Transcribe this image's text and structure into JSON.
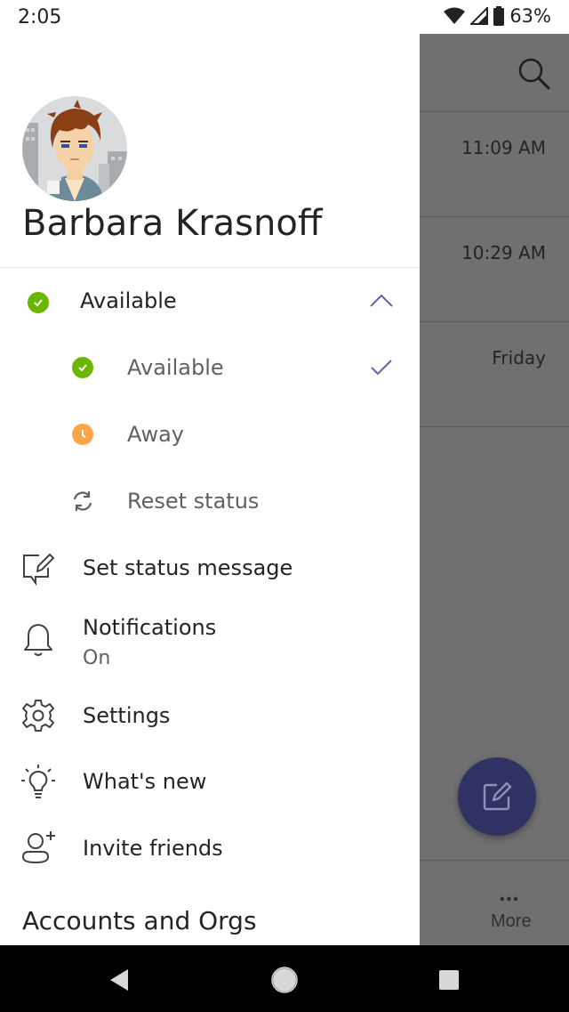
{
  "status_bar": {
    "time": "2:05",
    "battery": "63%"
  },
  "user": {
    "name": "Barbara Krasnoff"
  },
  "presence": {
    "current": "Available",
    "options": [
      {
        "label": "Available",
        "selected": true,
        "color": "#6bb700"
      },
      {
        "label": "Away",
        "selected": false,
        "color": "#f8a64a"
      },
      {
        "label": "Reset status",
        "selected": false
      }
    ]
  },
  "menu": {
    "set_status": "Set status message",
    "notifications": {
      "label": "Notifications",
      "value": "On"
    },
    "settings": "Settings",
    "whats_new": "What's new",
    "invite": "Invite friends"
  },
  "accounts_heading": "Accounts and Orgs",
  "background": {
    "times": [
      "11:09 AM",
      "10:29 AM",
      "Friday"
    ],
    "more_label": "More"
  },
  "colors": {
    "accent": "#6264a7",
    "available": "#6bb700",
    "away": "#f8a64a",
    "fab": "#2f3262"
  }
}
